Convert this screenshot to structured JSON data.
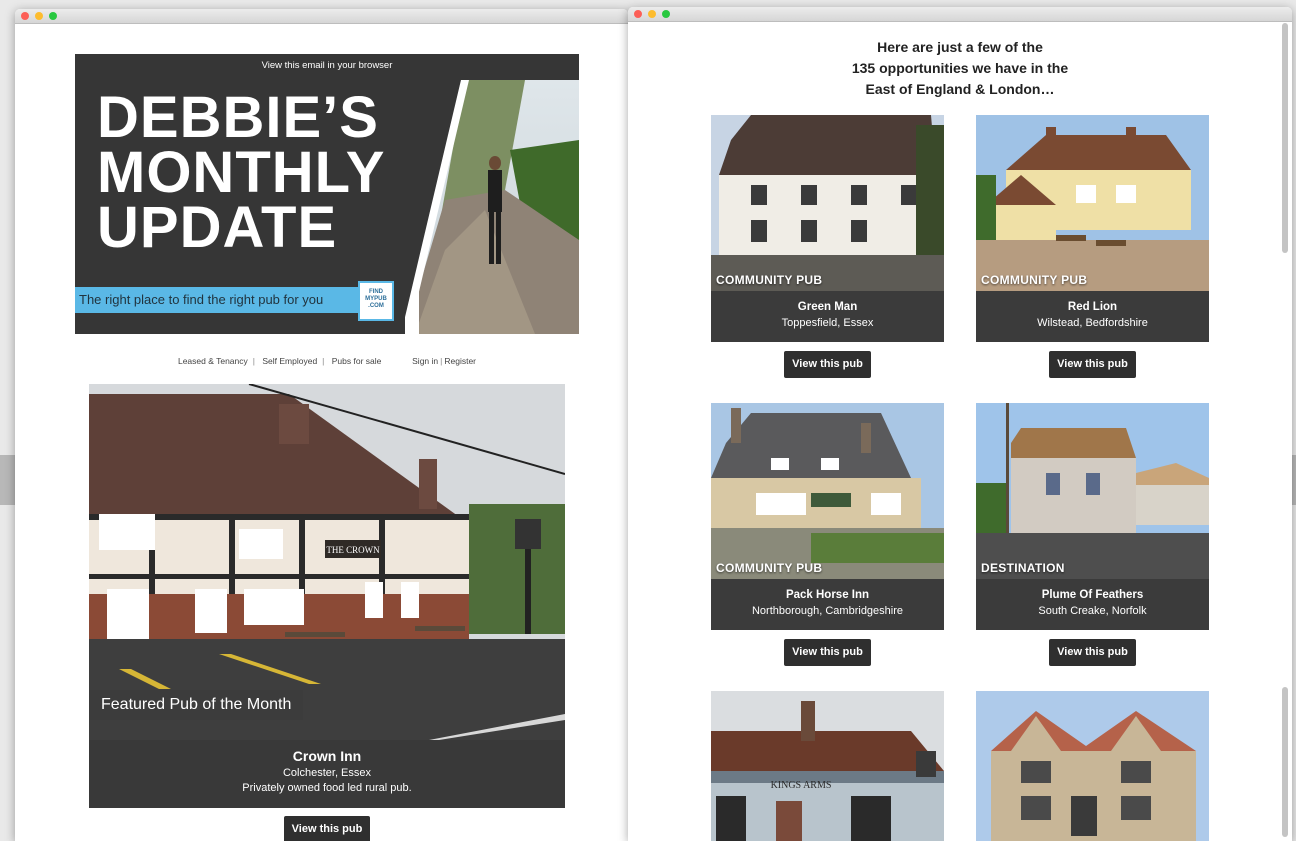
{
  "email1": {
    "view_in_browser": "View this email in your browser",
    "hero_title_lines": [
      "DEBBIE’S",
      "MONTHLY",
      "UPDATE"
    ],
    "tagline": "The right place to find the right pub for you",
    "logo_text": "FIND MYPUB .COM",
    "nav": {
      "leased": "Leased & Tenancy",
      "self_employed": "Self Employed",
      "for_sale": "Pubs for sale",
      "sign_in": "Sign in",
      "register": "Register"
    },
    "featured": {
      "label": "Featured Pub of the Month",
      "sign_text": "THE CROWN",
      "name": "Crown Inn",
      "location": "Colchester, Essex",
      "description": "Privately owned food led rural pub.",
      "button": "View this pub"
    }
  },
  "email2": {
    "intro_lines": [
      "Here are just a few of the",
      "135 opportunities we have in the",
      "East of England & London…"
    ],
    "pubs": [
      {
        "tag": "COMMUNITY PUB",
        "name": "Green Man",
        "location": "Toppesfield, Essex",
        "button": "View this pub"
      },
      {
        "tag": "COMMUNITY PUB",
        "name": "Red Lion",
        "location": "Wilstead, Bedfordshire",
        "button": "View this pub"
      },
      {
        "tag": "COMMUNITY PUB",
        "name": "Pack Horse Inn",
        "location": "Northborough, Cambridgeshire",
        "button": "View this pub"
      },
      {
        "tag": "DESTINATION",
        "name": "Plume Of Feathers",
        "location": "South Creake, Norfolk",
        "button": "View this pub"
      },
      {
        "tag": "",
        "name": "",
        "location": "",
        "button": ""
      },
      {
        "tag": "",
        "name": "",
        "location": "",
        "button": ""
      }
    ],
    "kings_arms_sign": "KINGS ARMS"
  },
  "colors": {
    "dark": "#363636",
    "tagline_blue": "#5ab8e6",
    "button": "#2f2f2f"
  }
}
